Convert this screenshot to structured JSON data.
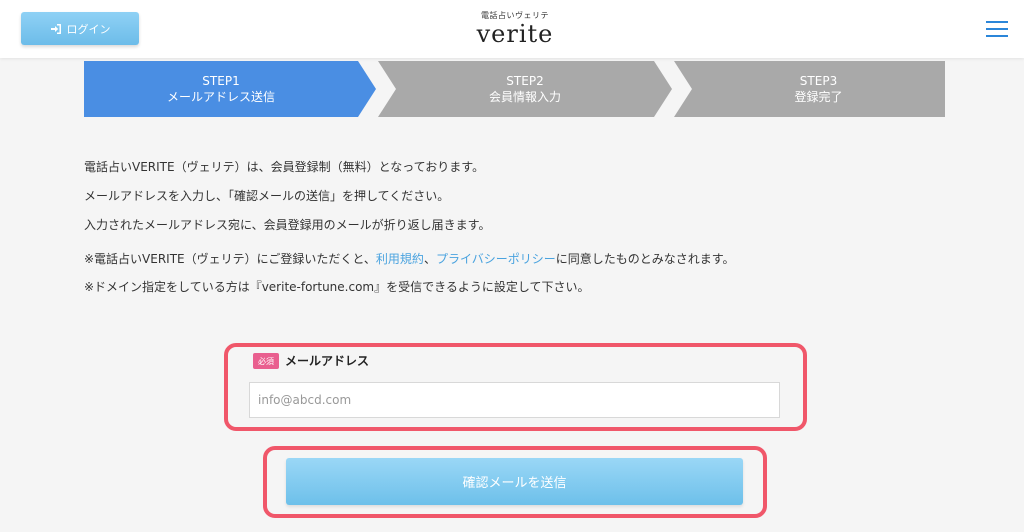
{
  "header": {
    "login_label": "ログイン",
    "logo_sub": "電話占いヴェリテ",
    "logo_main": "verite",
    "menu_icon": "hamburger-menu-icon"
  },
  "steps": [
    {
      "step": "STEP1",
      "label": "メールアドレス送信",
      "active": true
    },
    {
      "step": "STEP2",
      "label": "会員情報入力",
      "active": false
    },
    {
      "step": "STEP3",
      "label": "登録完了",
      "active": false
    }
  ],
  "intro": {
    "line1": "電話占いVERITE（ヴェリテ）は、会員登録制（無料）となっております。",
    "line2": "メールアドレスを入力し、「確認メールの送信」を押してください。",
    "line3": "入力されたメールアドレス宛に、会員登録用のメールが折り返し届きます。"
  },
  "notes": {
    "agree_prefix": "※電話占いVERITE（ヴェリテ）にご登録いただくと、",
    "terms_link": "利用規約",
    "separator": "、",
    "privacy_link": "プライバシーポリシー",
    "agree_suffix": "に同意したものとみなされます。",
    "domain_note": "※ドメイン指定をしている方は『verite-fortune.com』を受信できるように設定して下さい。"
  },
  "form": {
    "required_badge": "必須",
    "email_label": "メールアドレス",
    "email_placeholder": "info@abcd.com",
    "email_value": "",
    "submit_label": "確認メールを送信"
  },
  "colors": {
    "active_step": "#4a8ee3",
    "inactive_step": "#a9a9a9",
    "highlight_border": "#f0576a",
    "button": "#7cc8ee",
    "link": "#4aa3df"
  }
}
